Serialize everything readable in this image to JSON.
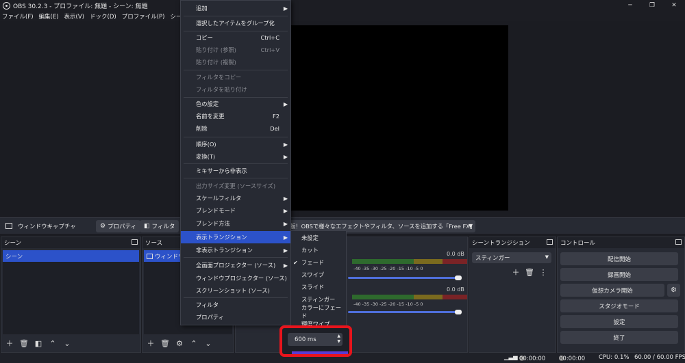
{
  "window": {
    "title": "OBS 30.2.3 - プロファイル: 無題 - シーン: 無題",
    "controls": [
      "─",
      "❐",
      "✕"
    ]
  },
  "menubar": {
    "items": [
      "ファイル(F)",
      "編集(E)",
      "表示(V)",
      "ドック(D)",
      "プロファイル(P)",
      "シーンコレクシ"
    ]
  },
  "context_bar": {
    "source_name": "ウィンドウキャプチャ",
    "properties_label": "プロパティ",
    "filters_label": "フィルタ",
    "window_select": "版！OBSで様々なエフェクトやフィルタ、ソースを追加する「Free FX」の使い方"
  },
  "scenes": {
    "header": "シーン",
    "items": [
      "シーン"
    ]
  },
  "sources": {
    "header": "ソース",
    "items": [
      "ウィンドウキ"
    ]
  },
  "mixer": {
    "tracks": [
      {
        "db": "0.0 dB",
        "ticks": "-40  -35  -30  -25  -20  -15  -10  -5   0"
      },
      {
        "db": "0.0 dB",
        "ticks": "-40  -35  -30  -25  -20  -15  -10  -5   0"
      }
    ]
  },
  "transitions": {
    "header": "シーントランジション",
    "selected": "スティンガー"
  },
  "controls": {
    "header": "コントロール",
    "buttons": [
      "配信開始",
      "録画開始",
      "仮想カメラ開始",
      "スタジオモード",
      "設定",
      "終了"
    ]
  },
  "statusbar": {
    "stream_time": "00:00:00",
    "record_time": "00:00:00",
    "cpu": "CPU: 0.1%",
    "fps": "60.00 / 60.00 FPS"
  },
  "context_menu": {
    "items": [
      {
        "label": "追加",
        "submenu": true
      },
      {
        "label": "選択したアイテムをグループ化"
      },
      {
        "label": "コピー",
        "shortcut": "Ctrl+C"
      },
      {
        "label": "貼り付け (参照)",
        "shortcut": "Ctrl+V",
        "disabled": true
      },
      {
        "label": "貼り付け (複製)",
        "disabled": true
      },
      {
        "label": "フィルタをコピー",
        "disabled": true
      },
      {
        "label": "フィルタを貼り付け",
        "disabled": true
      },
      {
        "label": "色の設定",
        "submenu": true
      },
      {
        "label": "名前を変更",
        "shortcut": "F2"
      },
      {
        "label": "削除",
        "shortcut": "Del"
      },
      {
        "label": "順序(O)",
        "submenu": true
      },
      {
        "label": "変換(T)",
        "submenu": true
      },
      {
        "label": "ミキサーから非表示"
      },
      {
        "label": "出力サイズ変更 (ソースサイズ)",
        "disabled": true
      },
      {
        "label": "スケールフィルタ",
        "submenu": true
      },
      {
        "label": "ブレンドモード",
        "submenu": true
      },
      {
        "label": "ブレンド方法",
        "submenu": true
      },
      {
        "label": "表示トランジション",
        "submenu": true,
        "highlight": true
      },
      {
        "label": "非表示トランジション",
        "submenu": true
      },
      {
        "label": "全画面プロジェクター (ソース)",
        "submenu": true
      },
      {
        "label": "ウィンドウプロジェクター (ソース)"
      },
      {
        "label": "スクリーンショット (ソース)"
      },
      {
        "label": "フィルタ"
      },
      {
        "label": "プロパティ"
      }
    ]
  },
  "transition_submenu": {
    "items": [
      "未設定",
      "カット",
      "フェード",
      "スワイプ",
      "スライド",
      "スティンガー",
      "カラーにフェード",
      "輝度ワイプ"
    ],
    "checked": "フェード"
  },
  "duration": {
    "value": "600 ms"
  }
}
